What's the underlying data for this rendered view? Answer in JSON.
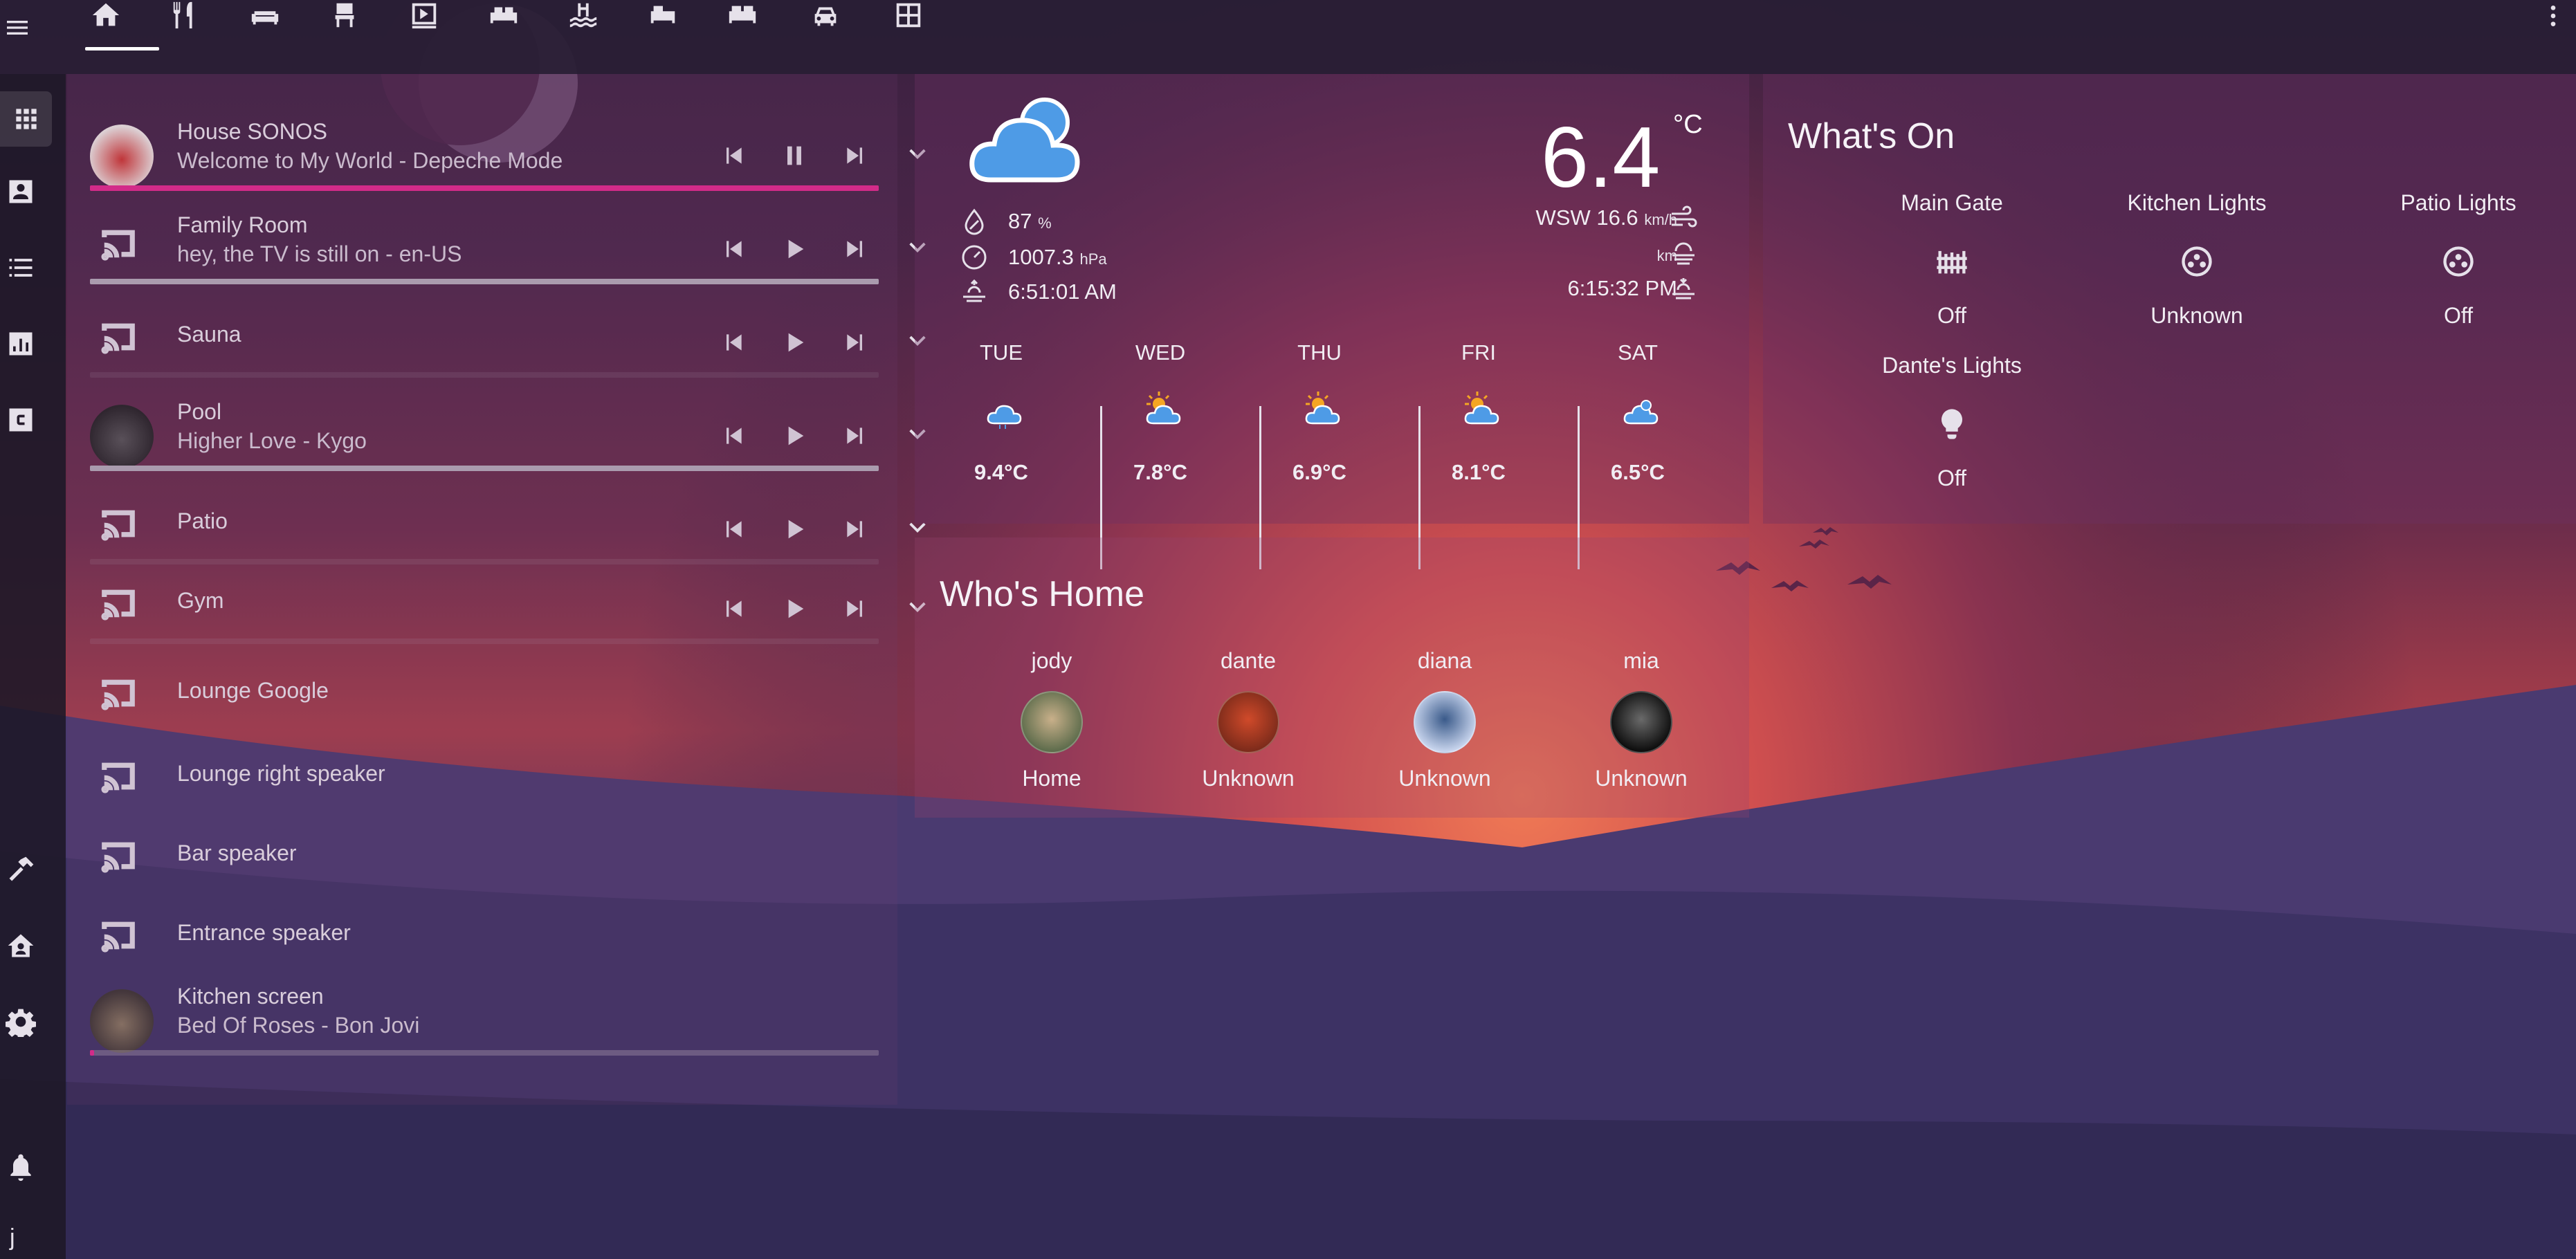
{
  "nav": {
    "tabs": [
      {
        "icon": "home-icon"
      },
      {
        "icon": "silverware-icon"
      },
      {
        "icon": "sofa-icon"
      },
      {
        "icon": "chair-icon"
      },
      {
        "icon": "theater-icon"
      },
      {
        "icon": "bed-icon"
      },
      {
        "icon": "pool-icon"
      },
      {
        "icon": "bed-single-icon"
      },
      {
        "icon": "bed-double-icon"
      },
      {
        "icon": "car-icon"
      },
      {
        "icon": "floor-plan-icon"
      }
    ],
    "selected_tab": 0
  },
  "sidebar": {
    "items": [
      {
        "icon": "apps-icon"
      },
      {
        "icon": "account-box-icon"
      },
      {
        "icon": "format-list-icon"
      },
      {
        "icon": "chart-box-icon"
      },
      {
        "icon": "c-box-icon"
      },
      {
        "icon": "hammer-icon"
      },
      {
        "icon": "home-account-icon"
      },
      {
        "icon": "cog-icon"
      },
      {
        "icon": "bell-icon"
      }
    ],
    "user_initial": "j"
  },
  "media": {
    "players": [
      {
        "name": "House SONOS",
        "subtitle": "Welcome to My World - Depeche Mode",
        "state": "playing",
        "has_art": true,
        "progress": 1.0,
        "progress_color": "#e8288f",
        "has_controls": true
      },
      {
        "name": "Family Room",
        "subtitle": "hey, the TV is still on - en-US",
        "state": "paused",
        "has_art": false,
        "progress": 1.0,
        "progress_color": "#b8b0bc",
        "has_controls": true
      },
      {
        "name": "Sauna",
        "subtitle": "",
        "state": "paused",
        "has_art": false,
        "progress": 0,
        "progress_color": "#b8b0bc",
        "has_controls": true
      },
      {
        "name": "Pool",
        "subtitle": "Higher Love - Kygo",
        "state": "paused",
        "has_art": true,
        "progress": 1.0,
        "progress_color": "#b8b0bc",
        "has_controls": true
      },
      {
        "name": "Patio",
        "subtitle": "",
        "state": "paused",
        "has_art": false,
        "progress": 0,
        "progress_color": "#b8b0bc",
        "has_controls": true
      },
      {
        "name": "Gym",
        "subtitle": "",
        "state": "paused",
        "has_art": false,
        "progress": 0,
        "progress_color": "#b8b0bc",
        "has_controls": true
      },
      {
        "name": "Lounge Google",
        "subtitle": "",
        "has_art": false,
        "has_controls": false
      },
      {
        "name": "Lounge right speaker",
        "subtitle": "",
        "has_art": false,
        "has_controls": false
      },
      {
        "name": "Bar speaker",
        "subtitle": "",
        "has_art": false,
        "has_controls": false
      },
      {
        "name": "Entrance speaker",
        "subtitle": "",
        "has_art": false,
        "has_controls": false
      },
      {
        "name": "Kitchen screen",
        "subtitle": "Bed Of Roses - Bon Jovi",
        "has_art": true,
        "progress": 0.005,
        "progress_color": "#e8288f",
        "has_controls": false
      }
    ]
  },
  "weather": {
    "current_icon": "cloudy-icon",
    "temperature": "6.4",
    "unit": "°C",
    "humidity": "87",
    "humidity_unit": "%",
    "pressure": "1007.3",
    "pressure_unit": "hPa",
    "sunrise": "6:51:01 AM",
    "wind": "WSW 16.6",
    "wind_unit": "km/h",
    "visibility_unit": "km",
    "sunset": "6:15:32 PM",
    "forecast": [
      {
        "day": "TUE",
        "icon": "rainy-icon",
        "temp": "9.4°C"
      },
      {
        "day": "WED",
        "icon": "partly-cloudy-icon",
        "temp": "7.8°C"
      },
      {
        "day": "THU",
        "icon": "partly-cloudy-icon",
        "temp": "6.9°C"
      },
      {
        "day": "FRI",
        "icon": "partly-cloudy-icon",
        "temp": "8.1°C"
      },
      {
        "day": "SAT",
        "icon": "cloudy-icon",
        "temp": "6.5°C"
      }
    ]
  },
  "whos_home": {
    "title": "Who's Home",
    "people": [
      {
        "name": "jody",
        "state": "Home"
      },
      {
        "name": "dante",
        "state": "Unknown"
      },
      {
        "name": "diana",
        "state": "Unknown"
      },
      {
        "name": "mia",
        "state": "Unknown"
      }
    ]
  },
  "whats_on": {
    "title": "What's On",
    "entities": [
      {
        "name": "Main Gate",
        "icon": "gate-icon",
        "state": "Off"
      },
      {
        "name": "Kitchen Lights",
        "icon": "ceiling-light-icon",
        "state": "Unknown"
      },
      {
        "name": "Patio Lights",
        "icon": "ceiling-light-icon",
        "state": "Off"
      },
      {
        "name": "Dante's Lights",
        "icon": "lightbulb-icon",
        "state": "Off"
      }
    ]
  },
  "colors": {
    "accent": "#e8288f",
    "weather_icon": "#4e9be6",
    "sun": "#f5a623"
  }
}
